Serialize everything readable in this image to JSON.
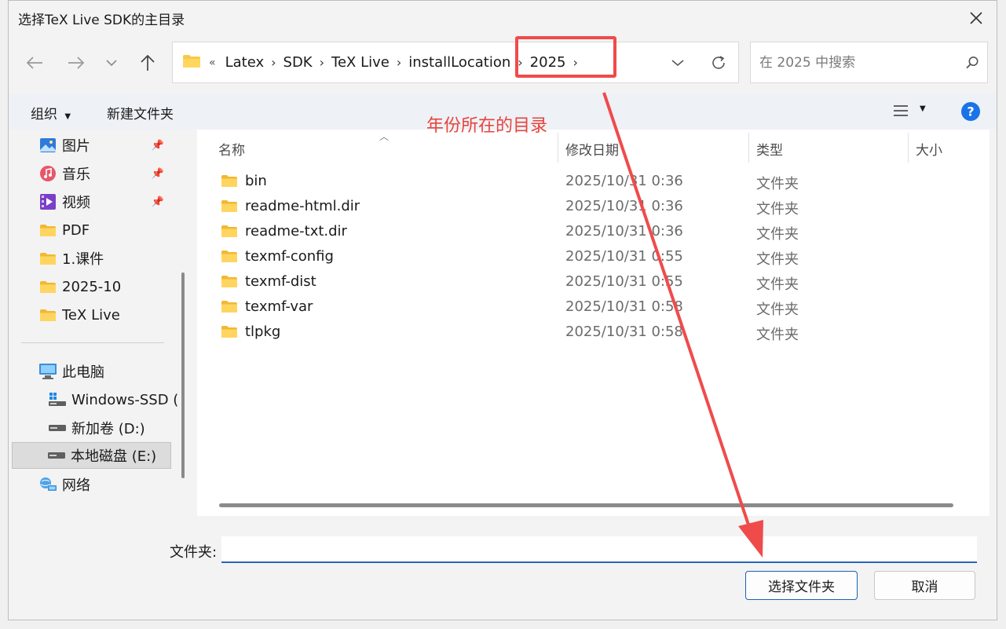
{
  "window": {
    "title": "选择TeX Live SDK的主目录"
  },
  "address": {
    "overflow": "«",
    "crumbs": [
      "Latex",
      "SDK",
      "TeX Live",
      "installLocation",
      "2025"
    ]
  },
  "search": {
    "placeholder": "在 2025 中搜索"
  },
  "toolbar": {
    "organize_label": "组织",
    "new_folder_label": "新建文件夹"
  },
  "sidebar": {
    "items": [
      {
        "label": "图片",
        "icon": "pictures-icon"
      },
      {
        "label": "音乐",
        "icon": "music-icon"
      },
      {
        "label": "视频",
        "icon": "videos-icon"
      },
      {
        "label": "PDF",
        "icon": "folder-icon"
      },
      {
        "label": "1.课件",
        "icon": "folder-icon"
      },
      {
        "label": "2025-10",
        "icon": "folder-icon"
      },
      {
        "label": "TeX Live",
        "icon": "folder-icon"
      },
      {
        "label": "此电脑",
        "icon": "computer-icon"
      },
      {
        "label": "Windows-SSD (",
        "icon": "windows-drive-icon"
      },
      {
        "label": "新加卷 (D:)",
        "icon": "drive-icon"
      },
      {
        "label": "本地磁盘 (E:)",
        "icon": "drive-icon"
      },
      {
        "label": "网络",
        "icon": "network-icon"
      }
    ]
  },
  "columns": {
    "name": "名称",
    "date": "修改日期",
    "type": "类型",
    "size": "大小"
  },
  "files": [
    {
      "name": "bin",
      "date": "2025/10/31 0:36",
      "type": "文件夹"
    },
    {
      "name": "readme-html.dir",
      "date": "2025/10/31 0:36",
      "type": "文件夹"
    },
    {
      "name": "readme-txt.dir",
      "date": "2025/10/31 0:36",
      "type": "文件夹"
    },
    {
      "name": "texmf-config",
      "date": "2025/10/31 0:55",
      "type": "文件夹"
    },
    {
      "name": "texmf-dist",
      "date": "2025/10/31 0:55",
      "type": "文件夹"
    },
    {
      "name": "texmf-var",
      "date": "2025/10/31 0:58",
      "type": "文件夹"
    },
    {
      "name": "tlpkg",
      "date": "2025/10/31 0:58",
      "type": "文件夹"
    }
  ],
  "annotation": {
    "text": "年份所在的目录",
    "color": "#e8433c"
  },
  "footer": {
    "folder_label": "文件夹:",
    "folder_value": "",
    "select_button": "选择文件夹",
    "cancel_button": "取消"
  },
  "colors": {
    "folder": "#f7c948",
    "accent": "#1f5fb4",
    "help": "#1a73e8"
  }
}
